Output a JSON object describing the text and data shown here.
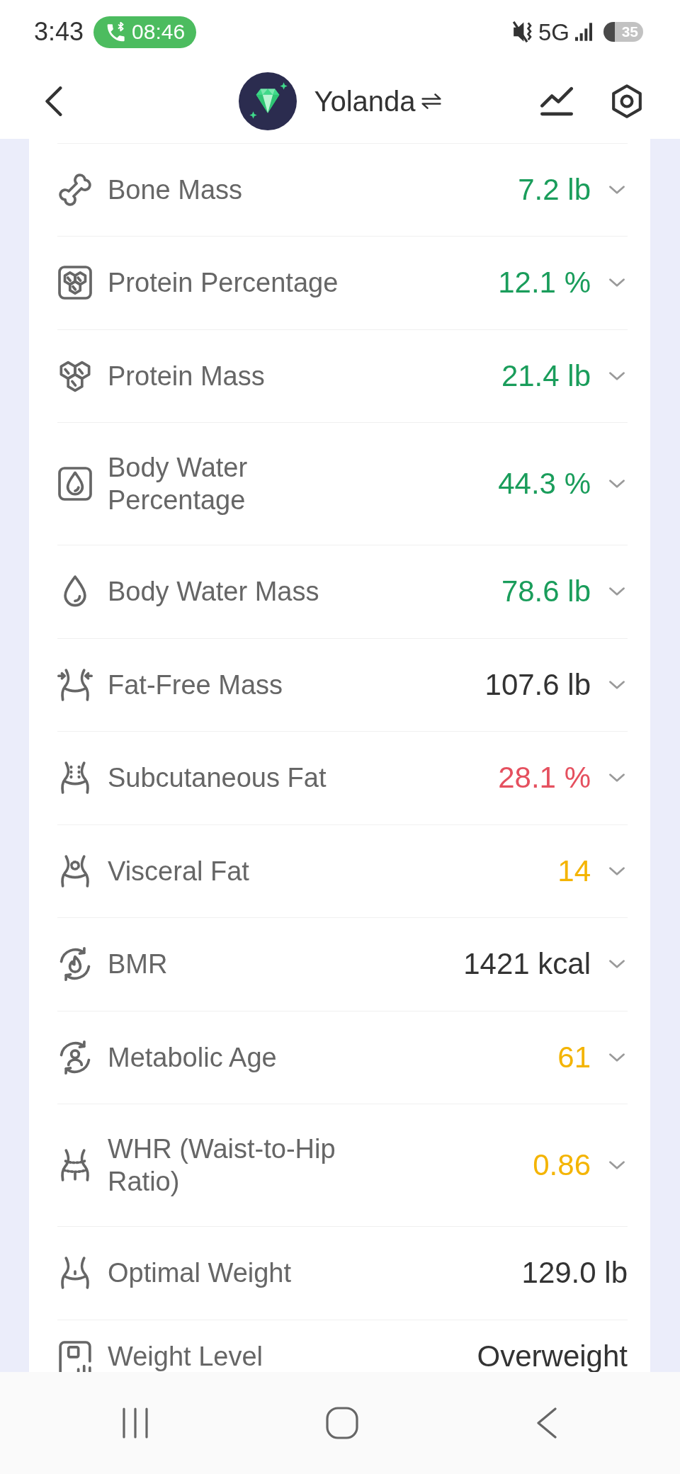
{
  "status_bar": {
    "time": "3:43",
    "call_timer": "08:46",
    "network": "5G",
    "battery": "35"
  },
  "header": {
    "user_name": "Yolanda"
  },
  "metrics": [
    {
      "label": "Bone Mass",
      "value": "7.2 lb",
      "color": "#1a9d5b",
      "kind": "expandable"
    },
    {
      "label": "Protein Percentage",
      "value": "12.1 %",
      "color": "#1a9d5b",
      "kind": "expandable"
    },
    {
      "label": "Protein Mass",
      "value": "21.4 lb",
      "color": "#1a9d5b",
      "kind": "expandable"
    },
    {
      "label": "Body Water Percentage",
      "value": "44.3 %",
      "color": "#1a9d5b",
      "kind": "expandable"
    },
    {
      "label": "Body Water Mass",
      "value": "78.6 lb",
      "color": "#1a9d5b",
      "kind": "expandable"
    },
    {
      "label": "Fat-Free Mass",
      "value": "107.6 lb",
      "color": "#333333",
      "kind": "expandable"
    },
    {
      "label": "Subcutaneous Fat",
      "value": "28.1 %",
      "color": "#e5505f",
      "kind": "expandable"
    },
    {
      "label": "Visceral Fat",
      "value": "14",
      "color": "#f4b400",
      "kind": "expandable"
    },
    {
      "label": "BMR",
      "value": "1421 kcal",
      "color": "#333333",
      "kind": "expandable"
    },
    {
      "label": "Metabolic Age",
      "value": "61",
      "color": "#f4b400",
      "kind": "expandable"
    },
    {
      "label": "WHR (Waist-to-Hip Ratio)",
      "value": "0.86",
      "color": "#f4b400",
      "kind": "expandable"
    },
    {
      "label": "Optimal Weight",
      "value": "129.0 lb",
      "color": "#333333",
      "kind": "static"
    },
    {
      "label": "Weight Level",
      "value": "Overweight",
      "color": "#333333",
      "kind": "static"
    }
  ]
}
